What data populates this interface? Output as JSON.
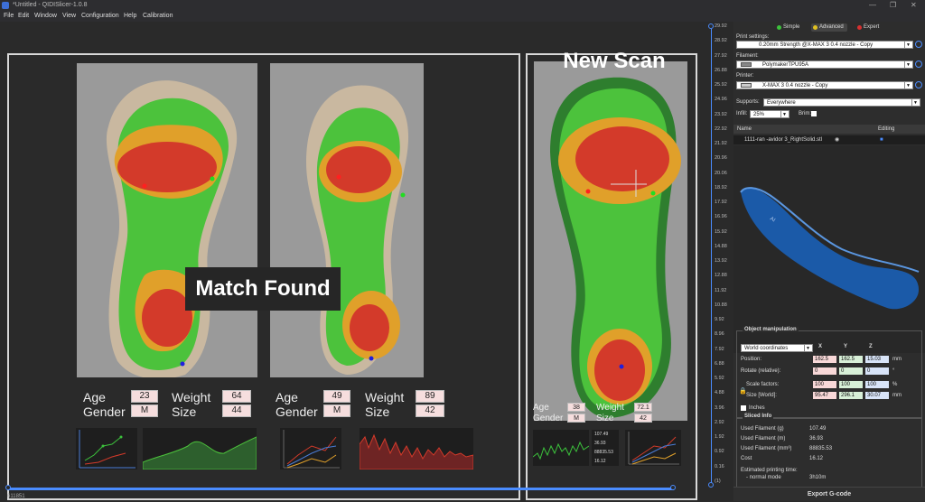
{
  "window": {
    "title": "*Untitled - QIDISlicer-1.0.8"
  },
  "menu": [
    "File",
    "Edit",
    "Window",
    "View",
    "Configuration",
    "Help",
    "Calibration"
  ],
  "overlay": {
    "match_label": "Match Found",
    "new_scan_label": "New Scan"
  },
  "profiles": [
    {
      "age_label": "Age",
      "age": "23",
      "gender_label": "Gender",
      "gender": "M",
      "weight_label": "Weight",
      "weight": "64",
      "size_label": "Size",
      "size": "44"
    },
    {
      "age_label": "Age",
      "age": "49",
      "gender_label": "Gender",
      "gender": "M",
      "weight_label": "Weight",
      "weight": "89",
      "size_label": "Size",
      "size": "42"
    },
    {
      "age_label": "Age",
      "age": "38",
      "gender_label": "Gender",
      "gender": "M",
      "weight_label": "Weight",
      "weight": "72.1",
      "size_label": "Size",
      "size": "42"
    }
  ],
  "mini_stats": [
    "107.49",
    "36.93",
    "88835.53",
    "16.12"
  ],
  "ruler": {
    "ticks": [
      "29.92",
      "28.92",
      "27.92",
      "26.88",
      "25.92",
      "24.96",
      "23.92",
      "22.92",
      "21.92",
      "20.96",
      "20.06",
      "18.92",
      "17.92",
      "16.96",
      "15.92",
      "14.88",
      "13.92",
      "12.88",
      "11.92",
      "10.88",
      "9.92",
      "8.96",
      "7.92",
      "6.88",
      "5.92",
      "4.88",
      "3.96",
      "2.92",
      "1.92",
      "0.92",
      "0.16",
      "(1)"
    ]
  },
  "status": {
    "coords": "611851"
  },
  "sidebar": {
    "modes": [
      {
        "label": "Simple",
        "color": "#3cc23c"
      },
      {
        "label": "Advanced",
        "color": "#e0c020"
      },
      {
        "label": "Expert",
        "color": "#d83030"
      }
    ],
    "print_settings_label": "Print settings:",
    "print_settings_value": "0.20mm Strength @X-MAX 3 0.4 nozzle - Copy",
    "filament_label": "Filament:",
    "filament_value": "PolymakerTPU95A",
    "printer_label": "Printer:",
    "printer_value": "X-MAX 3 0.4 nozzle - Copy",
    "supports_label": "Supports:",
    "supports_value": "Everywhere",
    "infill_label": "Infill:",
    "infill_value": "25%",
    "brim_label": "Brim:",
    "table": {
      "name_header": "Name",
      "editing_header": "Editing",
      "object_name": "1111-ran -avidor 3_RightSolid.stl"
    },
    "object_manipulation": {
      "title": "Object manipulation",
      "coord_system": "World coordinates",
      "axes": [
        "X",
        "Y",
        "Z"
      ],
      "position_label": "Position:",
      "position": [
        "162.5",
        "162.5",
        "15.03"
      ],
      "position_unit": "mm",
      "rotate_label": "Rotate (relative):",
      "rotate": [
        "0",
        "0",
        "0"
      ],
      "rotate_unit": "°",
      "scale_label": "Scale factors:",
      "scale": [
        "100",
        "100",
        "100"
      ],
      "scale_unit": "%",
      "size_label": "Size [World]:",
      "size": [
        "95.47",
        "296.1",
        "30.07"
      ],
      "size_unit": "mm",
      "inches_label": "Inches"
    },
    "sliced_info": {
      "title": "Sliced Info",
      "rows": [
        {
          "label": "Used Filament (g)",
          "value": "107.49"
        },
        {
          "label": "Used Filament (m)",
          "value": "36.93"
        },
        {
          "label": "Used Filament (mm³)",
          "value": "88835.53"
        },
        {
          "label": "Cost",
          "value": "16.12"
        }
      ],
      "est_label": "Estimated printing time:",
      "mode_label": "- normal mode",
      "mode_value": "3h10m"
    },
    "export_label": "Export G-code"
  }
}
